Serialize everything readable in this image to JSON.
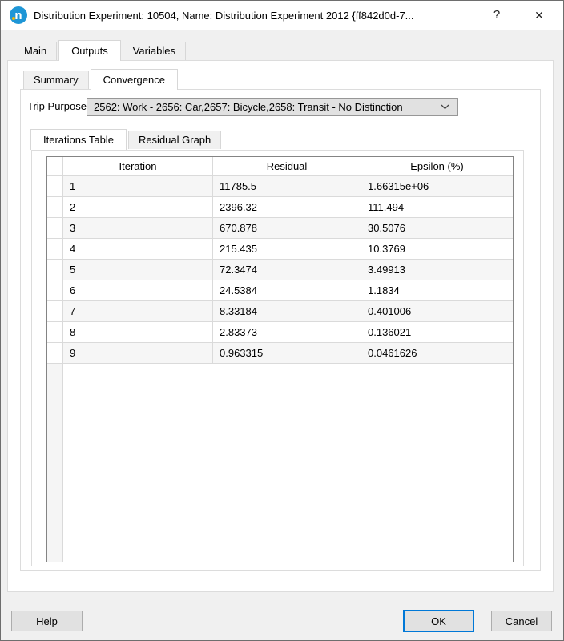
{
  "window": {
    "title": "Distribution Experiment: 10504, Name: Distribution Experiment 2012  {ff842d0d-7...",
    "icon_letter": "n",
    "help_glyph": "?",
    "close_glyph": "✕"
  },
  "main_tabs": [
    {
      "id": "main",
      "label": "Main",
      "active": false
    },
    {
      "id": "outputs",
      "label": "Outputs",
      "active": true
    },
    {
      "id": "variables",
      "label": "Variables",
      "active": false
    }
  ],
  "sub_tabs": [
    {
      "id": "summary",
      "label": "Summary",
      "active": false
    },
    {
      "id": "convergence",
      "label": "Convergence",
      "active": true
    }
  ],
  "trip_purpose": {
    "label": "Trip Purpose:",
    "value": "2562: Work - 2656: Car,2657: Bicycle,2658: Transit - No Distinction"
  },
  "view_tabs": [
    {
      "id": "iterations-table",
      "label": "Iterations Table",
      "active": true
    },
    {
      "id": "residual-graph",
      "label": "Residual Graph",
      "active": false
    }
  ],
  "table": {
    "columns": [
      "Iteration",
      "Residual",
      "Epsilon (%)"
    ],
    "rows": [
      [
        "1",
        "11785.5",
        "1.66315e+06"
      ],
      [
        "2",
        "2396.32",
        "111.494"
      ],
      [
        "3",
        "670.878",
        "30.5076"
      ],
      [
        "4",
        "215.435",
        "10.3769"
      ],
      [
        "5",
        "72.3474",
        "3.49913"
      ],
      [
        "6",
        "24.5384",
        "1.1834"
      ],
      [
        "7",
        "8.33184",
        "0.401006"
      ],
      [
        "8",
        "2.83373",
        "0.136021"
      ],
      [
        "9",
        "0.963315",
        "0.0461626"
      ]
    ]
  },
  "buttons": {
    "help": "Help",
    "ok": "OK",
    "cancel": "Cancel"
  },
  "colors": {
    "accent": "#0078d7",
    "icon_blue": "#1e96d6",
    "icon_dot": "#f2b705",
    "row_stripe": "#f6f6f6",
    "combo_bg": "#e1e1e1"
  }
}
